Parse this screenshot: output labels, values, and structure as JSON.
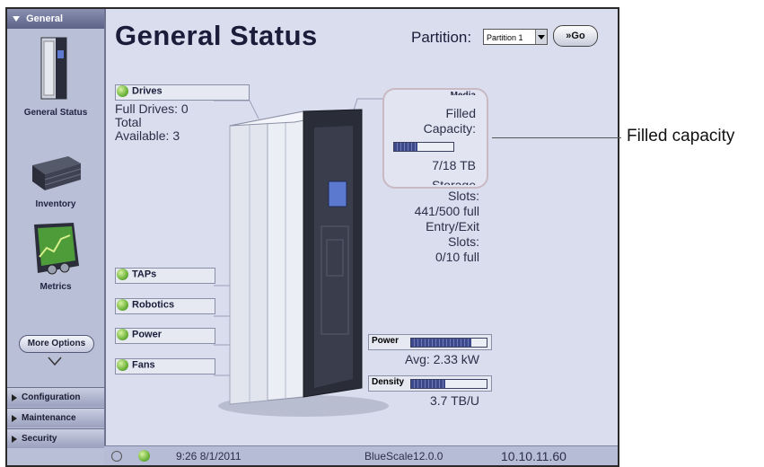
{
  "sidebar": {
    "header": "General",
    "items": [
      {
        "label": "General Status"
      },
      {
        "label": "Inventory"
      },
      {
        "label": "Metrics"
      }
    ],
    "more_options": "More Options",
    "sections": [
      "Configuration",
      "Maintenance",
      "Security"
    ]
  },
  "header": {
    "title": "General Status",
    "partition_label": "Partition:",
    "partition_value": "Partition 1",
    "go_label": "Go"
  },
  "status": {
    "drives": {
      "label": "Drives",
      "full": "Full Drives: 0",
      "total": "Total",
      "available": "Available: 3"
    },
    "taps": "TAPs",
    "robotics": "Robotics",
    "power": "Power",
    "fans": "Fans"
  },
  "capacity": {
    "header": "Media",
    "filled_line1": "Filled",
    "filled_line2": "Capacity:",
    "value": "7/18 TB",
    "fill_fraction": 0.39,
    "partial_next": "Storage"
  },
  "slots": {
    "line1": "Slots:",
    "line2": "441/500 full",
    "line3": "Entry/Exit",
    "line4": "Slots:",
    "line5": "0/10 full"
  },
  "power": {
    "label": "Power",
    "fill_fraction": 0.8,
    "avg": "Avg: 2.33 kW"
  },
  "density": {
    "label": "Density",
    "fill_fraction": 0.45,
    "value": "3.7 TB/U"
  },
  "footer": {
    "time": "9:26 8/1/2011",
    "version": "BlueScale12.0.0",
    "ip": "10.10.11.60"
  },
  "annotation": {
    "label": "Filled capacity"
  },
  "colors": {
    "frame_bg": "#d9dded",
    "sidebar_bg": "#b9bfd6",
    "status_green": "#6eb43c",
    "bar_fill": "#3c4a8c"
  }
}
